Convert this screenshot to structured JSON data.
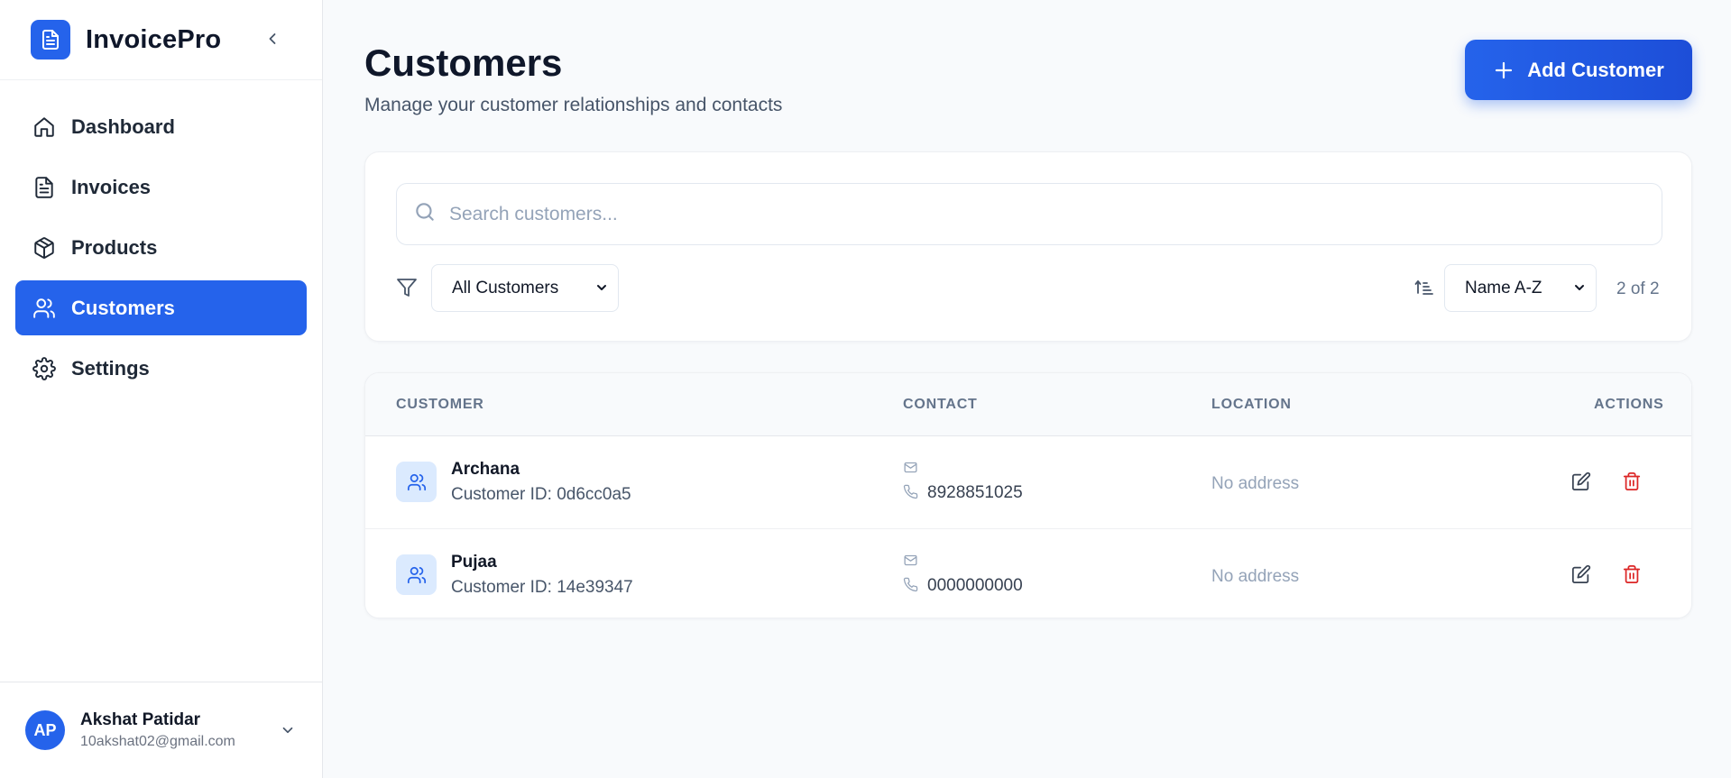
{
  "app": {
    "name": "InvoicePro"
  },
  "sidebar": {
    "items": [
      {
        "label": "Dashboard",
        "icon": "home-icon",
        "active": false
      },
      {
        "label": "Invoices",
        "icon": "file-text-icon",
        "active": false
      },
      {
        "label": "Products",
        "icon": "package-icon",
        "active": false
      },
      {
        "label": "Customers",
        "icon": "users-icon",
        "active": true
      },
      {
        "label": "Settings",
        "icon": "gear-icon",
        "active": false
      }
    ]
  },
  "user": {
    "initials": "AP",
    "name": "Akshat Patidar",
    "email": "10akshat02@gmail.com"
  },
  "page": {
    "title": "Customers",
    "subtitle": "Manage your customer relationships and contacts",
    "add_button": "Add Customer"
  },
  "filters": {
    "search_placeholder": "Search customers...",
    "type_filter": "All Customers",
    "sort": "Name A-Z",
    "count": "2 of 2"
  },
  "table": {
    "columns": [
      "CUSTOMER",
      "CONTACT",
      "LOCATION",
      "ACTIONS"
    ],
    "rows": [
      {
        "name": "Archana",
        "id_text": "Customer ID: 0d6cc0a5",
        "phone": "8928851025",
        "location": "No address"
      },
      {
        "name": "Pujaa",
        "id_text": "Customer ID: 14e39347",
        "phone": "0000000000",
        "location": "No address"
      }
    ]
  },
  "colors": {
    "accent": "#2563eb",
    "danger": "#dc2626",
    "muted": "#94a3b8"
  }
}
